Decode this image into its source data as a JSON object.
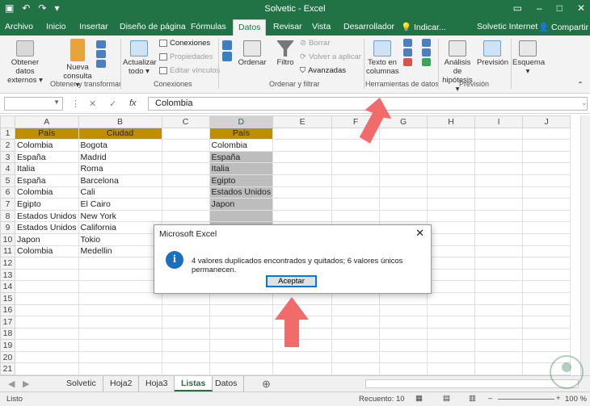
{
  "window": {
    "title": "Solvetic - Excel"
  },
  "tabs": [
    "Archivo",
    "Inicio",
    "Insertar",
    "Diseño de página",
    "Fórmulas",
    "Datos",
    "Revisar",
    "Vista",
    "Desarrollador",
    "Indicar...",
    "Solvetic Internet",
    "Compartir"
  ],
  "ribbon": {
    "obtener": "Obtener datos externos",
    "nueva": "Nueva consulta",
    "actualizar": "Actualizar todo",
    "conexiones": "Conexiones",
    "propiedades": "Propiedades",
    "editar": "Editar vínculos",
    "ordenar": "Ordenar",
    "filtro": "Filtro",
    "borrar": "Borrar",
    "volver": "Volver a aplicar",
    "avanzadas": "Avanzadas",
    "texto": "Texto en columnas",
    "analisis": "Análisis de hipótesis",
    "prevision": "Previsión",
    "esquema": "Esquema",
    "groups": [
      "Obtener y transformar",
      "Conexiones",
      "Ordenar y filtrar",
      "Herramientas de datos",
      "Previsión"
    ]
  },
  "formula": {
    "namebox": "",
    "value": "Colombia",
    "fx": "fx"
  },
  "columns": [
    "A",
    "B",
    "C",
    "D",
    "E",
    "F",
    "G",
    "H",
    "I",
    "J"
  ],
  "headers": {
    "A": "País",
    "B": "Ciudad",
    "D": "País"
  },
  "data": {
    "A": [
      "Colombia",
      "España",
      "Italia",
      "España",
      "Colombia",
      "Egipto",
      "Estados Unidos",
      "Estados Unidos",
      "Japon",
      "Colombia"
    ],
    "B": [
      "Bogota",
      "Madrid",
      "Roma",
      "Barcelona",
      "Cali",
      "El Cairo",
      "New York",
      "California",
      "Tokio",
      "Medellin"
    ],
    "D": [
      "Colombia",
      "España",
      "Italia",
      "Egipto",
      "Estados Unidos",
      "Japon",
      "",
      "",
      "",
      ""
    ]
  },
  "rows": 22,
  "sheets": [
    "Solvetic",
    "Hoja2",
    "Hoja3",
    "Listas",
    "Datos"
  ],
  "active_sheet": "Listas",
  "status": {
    "mode": "Listo",
    "count": "Recuento: 10",
    "zoom": "100 %"
  },
  "dialog": {
    "title": "Microsoft Excel",
    "message": "4 valores duplicados encontrados y quitados; 6 valores únicos permanecen.",
    "ok": "Aceptar"
  },
  "colors": {
    "excel_green": "#217346",
    "header_fill": "#bf8f00",
    "selected_fill": "#bdbdbd",
    "arrow": "#f26b6b"
  }
}
